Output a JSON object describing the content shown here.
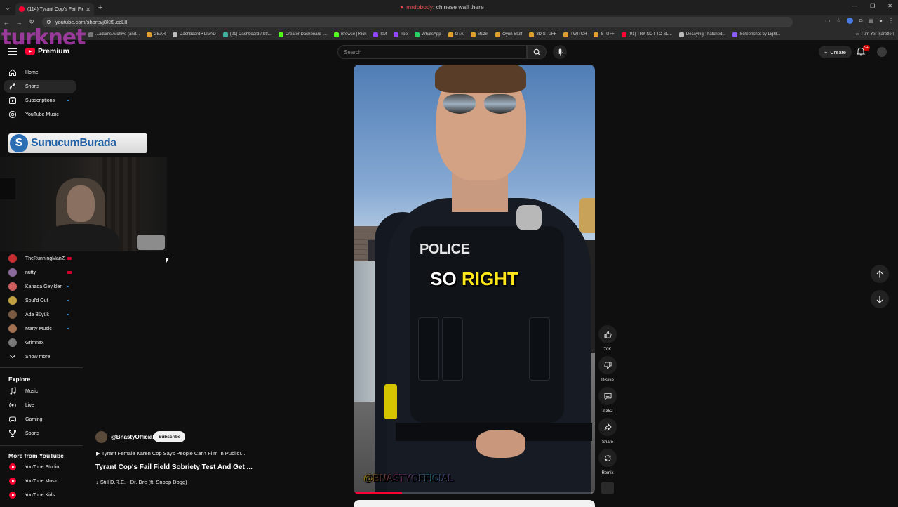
{
  "browser": {
    "tab_title": "(114) Tyrant Cop's Fail Field...",
    "url": "youtube.com/shorts/j8Xf8.ccLII",
    "bookmarks": [
      {
        "label": "...adams Archive (and...",
        "color": "#777777"
      },
      {
        "label": "GEAR",
        "color": "#e0a030"
      },
      {
        "label": "Dashboard • LIVAD",
        "color": "#bbbbbb"
      },
      {
        "label": "(21) Dashboard / Str...",
        "color": "#3fb3a0"
      },
      {
        "label": "Creator Dashboard |...",
        "color": "#53fc18"
      },
      {
        "label": "Browse | Kick",
        "color": "#53fc18"
      },
      {
        "label": "SM",
        "color": "#9146ff"
      },
      {
        "label": "Top",
        "color": "#9146ff"
      },
      {
        "label": "WhatsApp",
        "color": "#25d366"
      },
      {
        "label": "GTA",
        "color": "#e0a030"
      },
      {
        "label": "Müzik",
        "color": "#e0a030"
      },
      {
        "label": "Oyun Stuff",
        "color": "#e0a030"
      },
      {
        "label": "3D STUFF",
        "color": "#e0a030"
      },
      {
        "label": "TWITCH",
        "color": "#e0a030"
      },
      {
        "label": "STUFF",
        "color": "#e0a030"
      },
      {
        "label": "(91) TRY NOT TO SL...",
        "color": "#ff0033"
      },
      {
        "label": "Decaying Thatched...",
        "color": "#bbbbbb"
      },
      {
        "label": "Screenshot by Light...",
        "color": "#8a5cf6"
      }
    ],
    "all_bookmarks": "Tüm Yer İşaretleri"
  },
  "stream_overlay": {
    "watermark": "turknet",
    "ticker_user": "mrdobody",
    "ticker_message": ": chinese wall there",
    "banner_text": "SunucumBurada"
  },
  "header": {
    "logo_label": "Premium",
    "search_placeholder": "Search",
    "create_label": "Create",
    "notification_count": "9+"
  },
  "sidebar": {
    "main": [
      {
        "label": "Home",
        "icon": "home-icon"
      },
      {
        "label": "Shorts",
        "icon": "shorts-icon",
        "active": true
      },
      {
        "label": "Subscriptions",
        "icon": "subscriptions-icon"
      },
      {
        "label": "YouTube Music",
        "icon": "music-icon"
      }
    ],
    "channels": [
      {
        "label": "TheRunningManZ",
        "color": "#c03030"
      },
      {
        "label": "nutty",
        "color": "#8a6a9a"
      },
      {
        "label": "Kanada Geyikleri",
        "color": "#d06060"
      },
      {
        "label": "Soul'd Out",
        "color": "#c0a040"
      },
      {
        "label": "Ada Büyük",
        "color": "#7a5a40"
      },
      {
        "label": "Marty Music",
        "color": "#a07050"
      },
      {
        "label": "Grimnax",
        "color": "#7a7a7a"
      }
    ],
    "show_more": "Show more",
    "explore_heading": "Explore",
    "explore": [
      {
        "label": "Music",
        "icon": "music-note-icon"
      },
      {
        "label": "Live",
        "icon": "live-icon"
      },
      {
        "label": "Gaming",
        "icon": "gaming-icon"
      },
      {
        "label": "Sports",
        "icon": "trophy-icon"
      }
    ],
    "more_heading": "More from YouTube",
    "more": [
      {
        "label": "YouTube Studio"
      },
      {
        "label": "YouTube Music"
      },
      {
        "label": "YouTube Kids"
      }
    ]
  },
  "video": {
    "caption_white": "SO",
    "caption_yellow": "RIGHT",
    "overlay_handle": "@BNASTYOFFICIAL",
    "progress": 0.2
  },
  "actions": {
    "likes": "70K",
    "dislike": "Dislike",
    "comments": "2,352",
    "share": "Share",
    "remix": "Remix"
  },
  "meta": {
    "channel": "@BnastyOfficial",
    "subscribe": "Subscribe",
    "related": "Tyrant Female Karen Cop Says People Can't Film In Public!...",
    "title": "Tyrant Cop's Fail Field Sobriety Test And Get ...",
    "song": "Still D.R.E. - Dr. Dre (ft. Snoop Dogg)"
  }
}
